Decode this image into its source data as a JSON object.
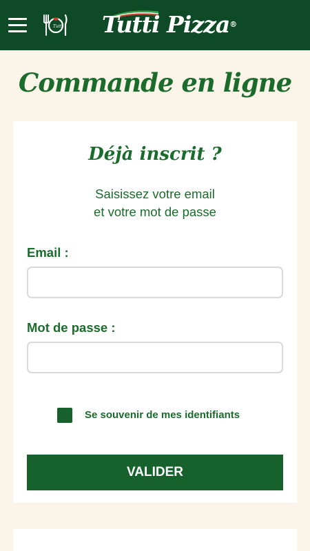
{
  "header": {
    "menu_icon": "hamburger-menu-icon",
    "restaurant_icon": "plate-fork-knife-icon",
    "logo_text": "Tutti Pizza",
    "logo_mark": "®",
    "background_color": "#0e4a25"
  },
  "page": {
    "title": "Commande en ligne",
    "background_color": "#fbf4e8",
    "accent_color": "#1a6b2c"
  },
  "login": {
    "title": "Déjà inscrit ?",
    "subtitle_line1": "Saisissez votre email",
    "subtitle_line2": "et votre mot de passe",
    "email_label": "Email :",
    "email_value": "",
    "password_label": "Mot de passe :",
    "password_value": "",
    "remember_label": "Se souvenir de mes identifiants",
    "submit_label": "VALIDER",
    "button_color": "#17612c"
  }
}
